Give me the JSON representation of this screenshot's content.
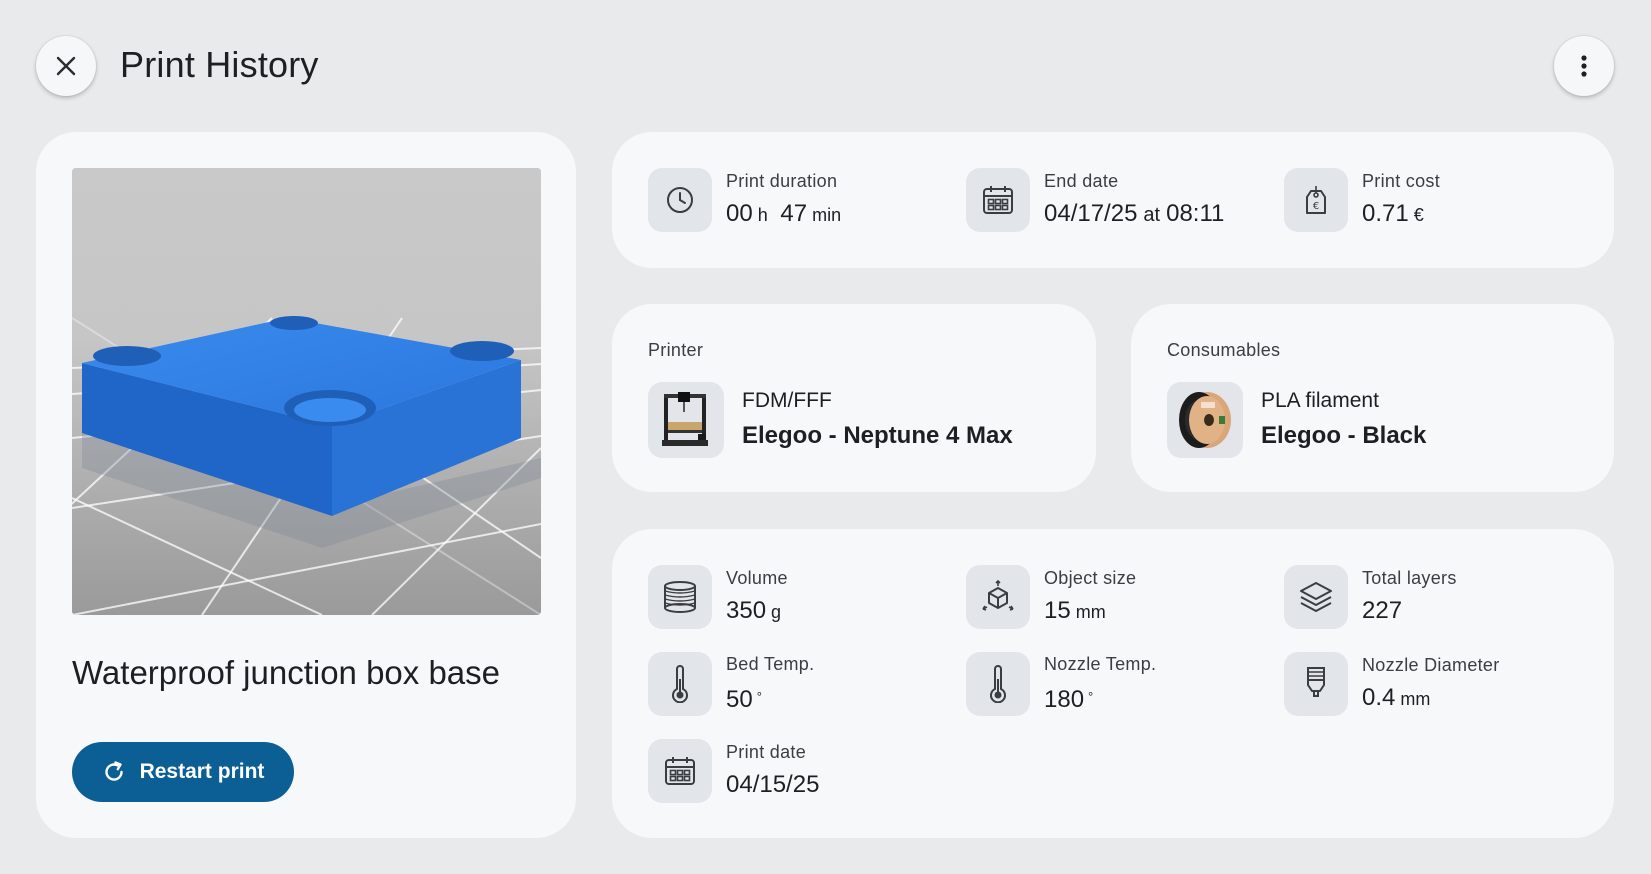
{
  "header": {
    "title": "Print History",
    "close_icon": "close-icon",
    "menu_icon": "more-vertical-icon"
  },
  "model": {
    "name": "Waterproof junction box base",
    "restart_label": "Restart print",
    "restart_icon": "refresh-icon",
    "preview_color": "#2a78d8"
  },
  "summary": {
    "duration": {
      "label": "Print duration",
      "hours": "00",
      "hours_unit": "h",
      "minutes": "47",
      "minutes_unit": "min",
      "icon": "clock-icon"
    },
    "end_date": {
      "label": "End date",
      "date": "04/17/25",
      "at": "at",
      "time": "08:11",
      "icon": "calendar-icon"
    },
    "cost": {
      "label": "Print cost",
      "value": "0.71",
      "unit": "€",
      "icon": "price-tag-euro-icon"
    }
  },
  "printer": {
    "section_label": "Printer",
    "type": "FDM/FFF",
    "name": "Elegoo - Neptune 4 Max",
    "icon": "3d-printer-thumbnail"
  },
  "consumables": {
    "section_label": "Consumables",
    "type": "PLA filament",
    "name": "Elegoo - Black",
    "icon": "filament-spool-thumbnail"
  },
  "stats": {
    "volume": {
      "label": "Volume",
      "value": "350",
      "unit": "g",
      "icon": "filament-spool-icon"
    },
    "object_size": {
      "label": "Object size",
      "value": "15",
      "unit": "mm",
      "icon": "cube-arrows-icon"
    },
    "total_layers": {
      "label": "Total layers",
      "value": "227",
      "icon": "layers-icon"
    },
    "bed_temp": {
      "label": "Bed Temp.",
      "value": "50",
      "unit": "°",
      "icon": "thermometer-icon"
    },
    "nozzle_temp": {
      "label": "Nozzle Temp.",
      "value": "180",
      "unit": "°",
      "icon": "thermometer-icon"
    },
    "nozzle_diameter": {
      "label": "Nozzle Diameter",
      "value": "0.4",
      "unit": "mm",
      "icon": "nozzle-icon"
    },
    "print_date": {
      "label": "Print date",
      "value": "04/15/25",
      "icon": "calendar-icon"
    }
  },
  "colors": {
    "background": "#e9eaec",
    "card": "#f7f8fa",
    "icon_box": "#e2e5ea",
    "accent": "#0c5f94"
  }
}
